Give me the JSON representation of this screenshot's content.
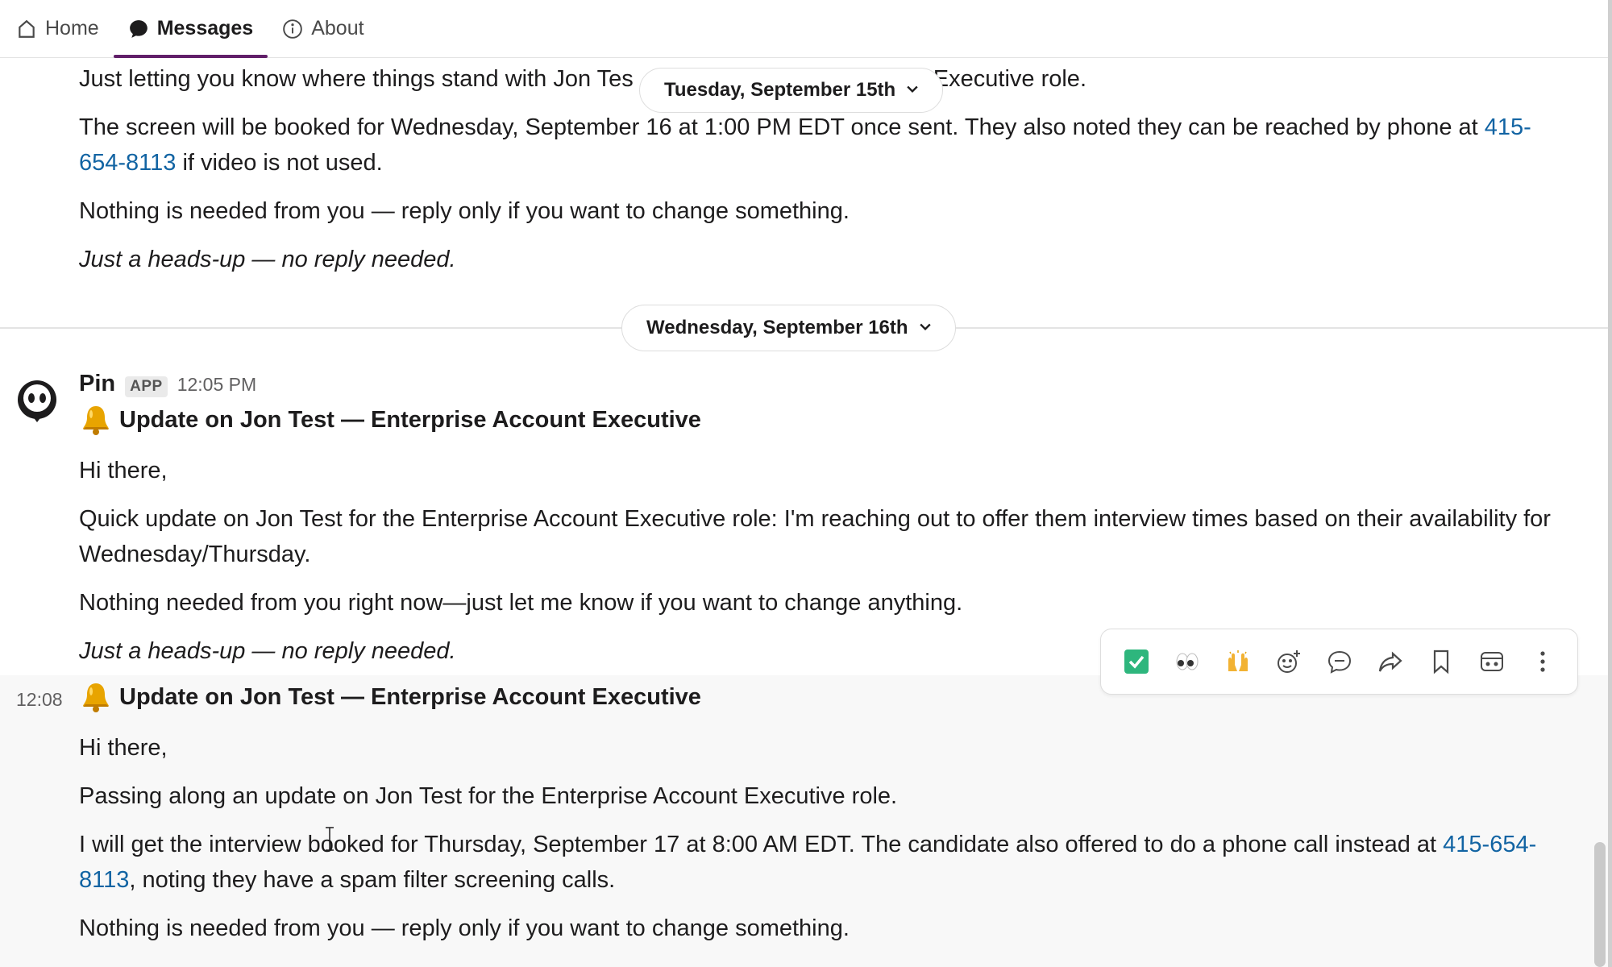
{
  "tabs": [
    {
      "label": "Home",
      "icon": "home-icon"
    },
    {
      "label": "Messages",
      "icon": "message-bubble-icon",
      "active": true
    },
    {
      "label": "About",
      "icon": "info-icon"
    }
  ],
  "prev_message": {
    "line1": "Just letting you know where things stand with Jon Tes",
    "line1_tail": "Executive role.",
    "line2_a": "The screen will be booked for Wednesday, September 16 at 1:00 PM EDT once sent. They also noted they can be reached by phone at ",
    "line2_link": "415-654-8113",
    "line2_b": " if video is not used.",
    "line3": "Nothing is needed from you — reply only if you want to change something.",
    "line4": "Just a heads-up — no reply needed."
  },
  "date_pills": {
    "sticky": "Tuesday, September 15th",
    "divider": "Wednesday, September 16th"
  },
  "message1": {
    "sender": "Pin",
    "badge": "APP",
    "time": "12:05 PM",
    "title": "Update on Jon Test — Enterprise Account Executive",
    "greeting": "Hi there,",
    "body": "Quick update on Jon Test for the Enterprise Account Executive role: I'm reaching out to offer them interview times based on their availability for Wednesday/Thursday.",
    "note": "Nothing needed from you right now—just let me know if you want to change anything.",
    "footer": "Just a heads-up — no reply needed."
  },
  "message2": {
    "time": "12:08",
    "title": "Update on Jon Test — Enterprise Account Executive",
    "greeting": "Hi there,",
    "line1": "Passing along an update on Jon Test for the Enterprise Account Executive role.",
    "line2_a": "I will get the interview booked for Thursday, September 17 at 8:00 AM EDT. The candidate also offered to do a phone call instead at ",
    "line2_link": "415-654-8113",
    "line2_b": ", noting they have a spam filter screening calls.",
    "line3": "Nothing is needed from you — reply only if you want to change something."
  },
  "action_bar": {
    "items": [
      "check-mark-emoji",
      "eyes-emoji",
      "raised-hands-emoji",
      "add-reaction-icon",
      "reply-thread-icon",
      "forward-icon",
      "bookmark-icon",
      "apps-icon",
      "more-actions-icon"
    ]
  },
  "colors": {
    "accent": "#611f69",
    "link": "#1264a3",
    "check_green": "#2eb67d"
  }
}
